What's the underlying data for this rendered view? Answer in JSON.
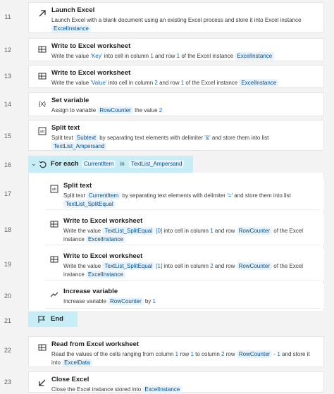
{
  "line_numbers": [
    "11",
    "12",
    "13",
    "14",
    "15",
    "16",
    "17",
    "18",
    "19",
    "20",
    "21",
    "22",
    "23"
  ],
  "actions": {
    "launch_excel": {
      "title": "Launch Excel",
      "desc_prefix": "Launch Excel with a blank document using an existing Excel process and store it into Excel instance",
      "var": "ExcelInstance"
    },
    "write_key": {
      "title": "Write to Excel worksheet",
      "t1": "Write the value ",
      "value": "'Key'",
      "t2": " into cell in column ",
      "col": "1",
      "t3": " and row ",
      "row": "1",
      "t4": " of the Excel instance ",
      "var": "ExcelInstance"
    },
    "write_value": {
      "title": "Write to Excel worksheet",
      "t1": "Write the value ",
      "value": "'Value'",
      "t2": " into cell in column ",
      "col": "2",
      "t3": " and row ",
      "row": "1",
      "t4": " of the Excel instance ",
      "var": "ExcelInstance"
    },
    "set_variable": {
      "title": "Set variable",
      "t1": "Assign to variable ",
      "var": "RowCounter",
      "t2": " the value ",
      "value": "2"
    },
    "split_text_1": {
      "title": "Split text",
      "t1": "Split text ",
      "var": "Subtext",
      "t2": " by separating text elements with delimiter ",
      "delim": "'&'",
      "t3": " and store them into list",
      "list": "TextList_Ampersand"
    },
    "for_each": {
      "title": "For each",
      "var": "CurrentItem",
      "in": "in",
      "list": "TextList_Ampersand"
    },
    "split_text_2": {
      "title": "Split text",
      "t1": "Split text ",
      "var": "CurrentItem",
      "t2": " by separating text elements with delimiter ",
      "delim": "'='",
      "t3": " and store them into list",
      "list": "TextList_SplitEqual"
    },
    "write_split_0": {
      "title": "Write to Excel worksheet",
      "t1": "Write the value ",
      "value": "TextList_SplitEqual",
      "index": "[0]",
      "t2": " into cell in column ",
      "col": "1",
      "t3": " and row ",
      "row": "RowCounter",
      "t4": " of the Excel",
      "t5": "instance ",
      "var": "ExcelInstance"
    },
    "write_split_1": {
      "title": "Write to Excel worksheet",
      "t1": "Write the value ",
      "value": "TextList_SplitEqual",
      "index": "[1]",
      "t2": " into cell in column ",
      "col": "2",
      "t3": " and row ",
      "row": "RowCounter",
      "t4": " of the Excel",
      "t5": "instance ",
      "var": "ExcelInstance"
    },
    "increase_variable": {
      "title": "Increase variable",
      "t1": "Increase variable ",
      "var": "RowCounter",
      "t2": " by ",
      "value": "1"
    },
    "end": {
      "title": "End"
    },
    "read_excel": {
      "title": "Read from Excel worksheet",
      "t1": "Read the values of the cells ranging from column ",
      "c1": "1",
      "t2": " row ",
      "r1": "1",
      "t3": " to column ",
      "c2": "2",
      "t4": " row ",
      "r2": "RowCounter",
      "t5": " - ",
      "minus": "1",
      "t6": " and store it",
      "t7": "into ",
      "var": "ExcelData"
    },
    "close_excel": {
      "title": "Close Excel",
      "t1": "Close the Excel instance stored into ",
      "var": "ExcelInstance"
    }
  },
  "icons": {
    "launch": "arrow-up-right-icon",
    "excel": "excel-sheet-icon",
    "variable": "variable-braces-icon",
    "split": "split-text-icon",
    "loop": "loop-icon",
    "increase": "trend-up-icon",
    "end": "flag-icon",
    "close": "arrow-down-left-icon"
  }
}
